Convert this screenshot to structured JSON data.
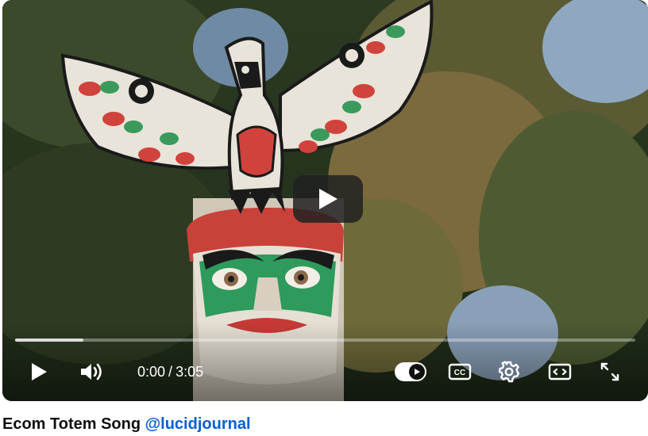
{
  "player": {
    "current_time": "0:00",
    "time_separator": "/",
    "duration": "3:05",
    "progress_played_fraction": 0.0,
    "progress_buffered_fraction": 0.11,
    "autoplay_on": true
  },
  "icons": {
    "center_play": "play-icon",
    "play": "play-icon",
    "volume": "volume-icon",
    "autoplay": "autoplay-toggle-icon",
    "captions": "closed-captions-icon",
    "settings": "gear-icon",
    "theater": "theater-mode-icon",
    "fullscreen": "fullscreen-icon"
  },
  "caption": {
    "title": "Ecom Totem Song",
    "handle": "@lucidjournal"
  },
  "colors": {
    "link": "#065fd4",
    "overlay_button": "#212121"
  }
}
